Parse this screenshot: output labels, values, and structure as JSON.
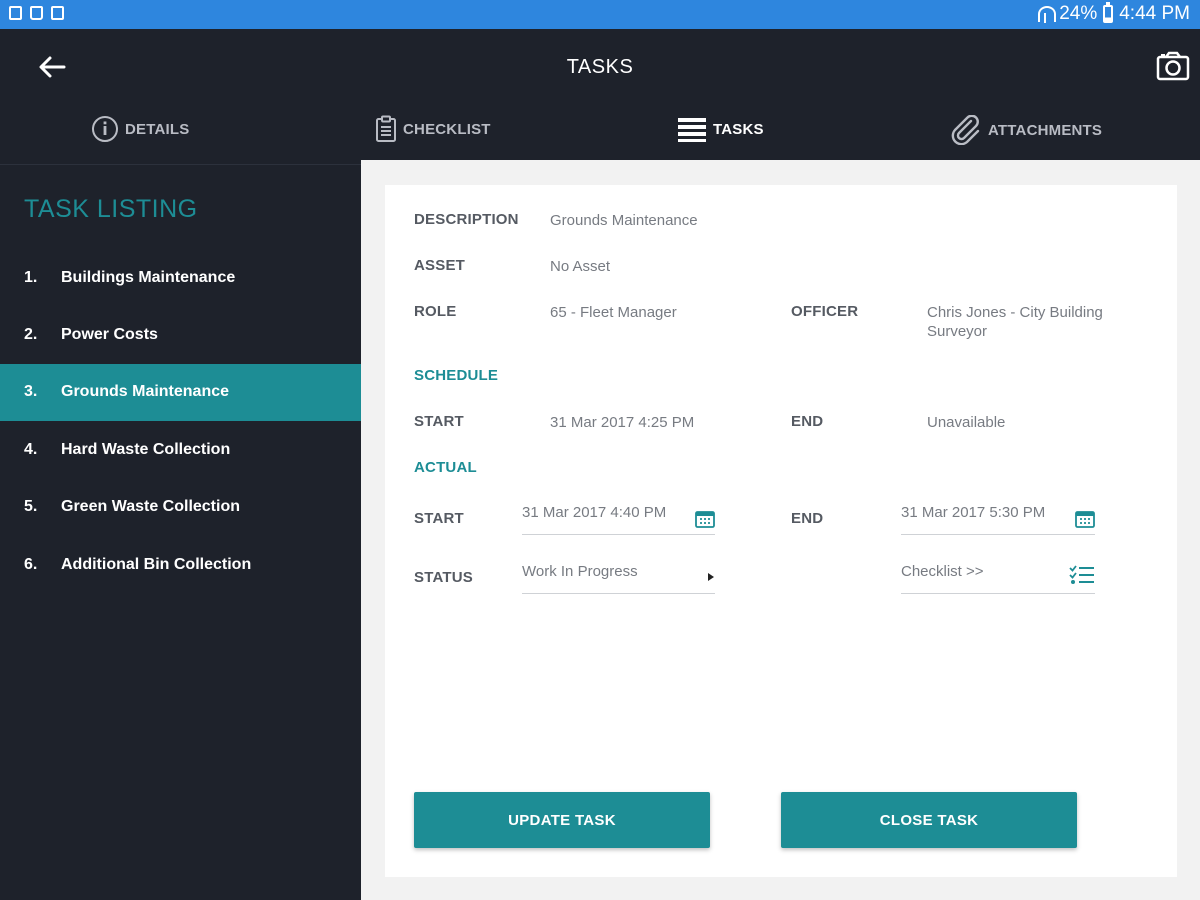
{
  "status_bar": {
    "battery": "24%",
    "time": "4:44 PM"
  },
  "app_bar": {
    "title": "TASKS"
  },
  "tabs": [
    {
      "label": "DETAILS",
      "icon": "info-icon"
    },
    {
      "label": "CHECKLIST",
      "icon": "clipboard-icon"
    },
    {
      "label": "TASKS",
      "icon": "list-icon",
      "active": true
    },
    {
      "label": "ATTACHMENTS",
      "icon": "paperclip-icon"
    }
  ],
  "sidebar": {
    "title": "TASK LISTING",
    "items": [
      {
        "num": "1.",
        "label": "Buildings Maintenance"
      },
      {
        "num": "2.",
        "label": "Power Costs"
      },
      {
        "num": "3.",
        "label": "Grounds Maintenance",
        "active": true
      },
      {
        "num": "4.",
        "label": "Hard Waste Collection"
      },
      {
        "num": "5.",
        "label": "Green Waste Collection"
      },
      {
        "num": "6.",
        "label": "Additional Bin Collection"
      }
    ]
  },
  "detail": {
    "description_label": "DESCRIPTION",
    "description": "Grounds Maintenance",
    "asset_label": "ASSET",
    "asset": "No Asset",
    "role_label": "ROLE",
    "role": "65 - Fleet Manager",
    "officer_label": "OFFICER",
    "officer": "Chris Jones - City Building Surveyor",
    "schedule_heading": "SCHEDULE",
    "schedule_start_label": "START",
    "schedule_start": "31 Mar 2017 4:25 PM",
    "schedule_end_label": "END",
    "schedule_end": "Unavailable",
    "actual_heading": "ACTUAL",
    "actual_start_label": "START",
    "actual_start": "31 Mar 2017 4:40 PM",
    "actual_end_label": "END",
    "actual_end": "31 Mar 2017 5:30 PM",
    "status_label": "STATUS",
    "status": "Work In Progress",
    "checklist_link": "Checklist >>"
  },
  "buttons": {
    "update": "UPDATE TASK",
    "close": "CLOSE TASK"
  },
  "colors": {
    "accent": "#1d8d95",
    "status_bar": "#2e86de",
    "dark_bg": "#1e222b"
  }
}
